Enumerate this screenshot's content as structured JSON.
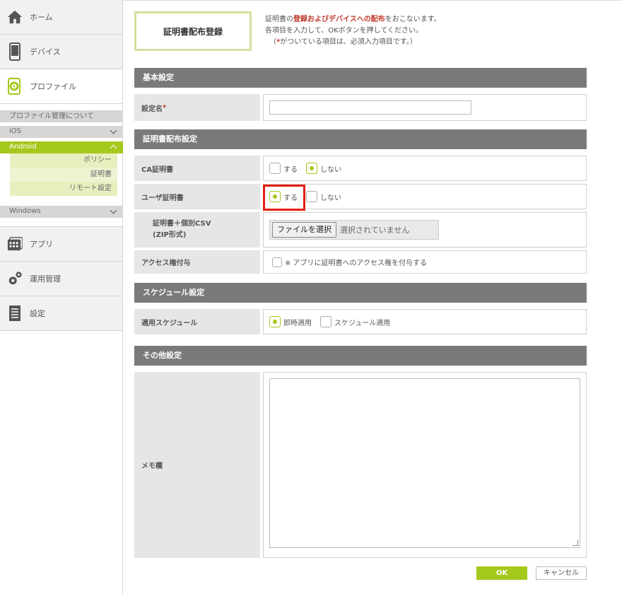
{
  "sidebar": {
    "home": {
      "label": "ホーム",
      "icon": "home-icon"
    },
    "device": {
      "label": "デバイス",
      "icon": "smartphone-icon"
    },
    "profile": {
      "label": "プロファイル",
      "icon": "profile-gear-icon"
    },
    "profile_about": "プロファイル管理について",
    "ios": "iOS",
    "android": "Android",
    "android_items": [
      "ポリシー",
      "証明書",
      "リモート設定"
    ],
    "windows": "Windows",
    "apps": {
      "label": "アプリ",
      "icon": "apps-icon"
    },
    "operations": {
      "label": "運用管理",
      "icon": "gears-icon"
    },
    "settings": {
      "label": "設定",
      "icon": "document-icon"
    }
  },
  "page": {
    "title": "証明書配布登録",
    "desc_pre": "証明書の",
    "desc_red": "登録およびデバイスへの配布",
    "desc_post": "をおこないます。",
    "desc_line2": "各項目を入力して、OKボタンを押してください。",
    "desc_line3_pre": "（",
    "desc_line3_star": "*",
    "desc_line3_post": "がついている項目は、必須入力項目です。）"
  },
  "sections": {
    "basic": "基本設定",
    "cert": "証明書配布設定",
    "schedule": "スケジュール設定",
    "other": "その他設定"
  },
  "fields": {
    "setting_name": {
      "label": "設定名",
      "required": "*",
      "value": ""
    },
    "ca_cert": {
      "label": "CA証明書",
      "opt_yes": "する",
      "opt_no": "しない",
      "selected": "しない"
    },
    "user_cert": {
      "label": "ユーザ証明書",
      "opt_yes": "する",
      "opt_no": "しない",
      "selected": "する"
    },
    "csv": {
      "label_line1": "証明書＋個別CSV",
      "label_line2": "(ZIP形式)",
      "button": "ファイルを選択",
      "status": "選択されていません"
    },
    "access": {
      "label": "アクセス権付与",
      "checkbox_label": "※ アプリに証明書へのアクセス権を付与する",
      "checked": false
    },
    "schedule": {
      "label": "適用スケジュール",
      "opt_now": "即時適用",
      "opt_sched": "スケジュール適用",
      "selected": "即時適用"
    },
    "memo": {
      "label": "メモ欄",
      "value": ""
    }
  },
  "buttons": {
    "ok": "OK",
    "cancel": "キャンセル"
  },
  "colors": {
    "accent": "#a5c81c",
    "highlight": "#e31e14",
    "section_header": "#7a7a7a"
  }
}
